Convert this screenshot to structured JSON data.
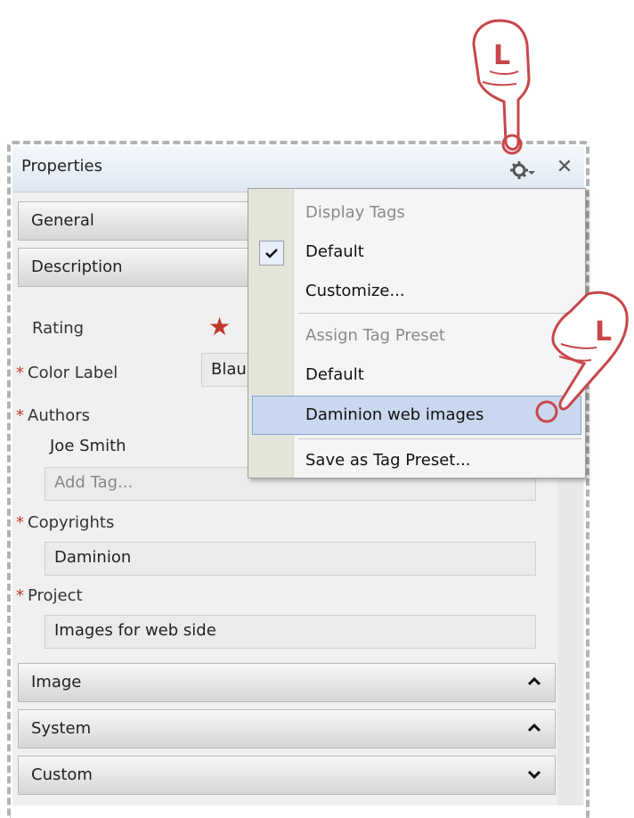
{
  "panel": {
    "title": "Properties"
  },
  "sections": {
    "general": "General",
    "description": "Description",
    "image": "Image",
    "system": "System",
    "custom": "Custom"
  },
  "fields": {
    "rating_label": "Rating",
    "color_label": "Color Label",
    "color_value": "Blau",
    "required_mark": "*",
    "authors_label": "Authors",
    "authors_value": "Joe Smith",
    "add_tag_placeholder": "Add Tag...",
    "copyrights_label": "Copyrights",
    "copyrights_value": "Daminion",
    "project_label": "Project",
    "project_value": "Images for web side"
  },
  "menu": {
    "display_tags_header": "Display Tags",
    "default_display": "Default",
    "customize": "Customize...",
    "assign_preset_header": "Assign Tag Preset",
    "default_preset": "Default",
    "daminion_web": "Daminion web images",
    "save_preset": "Save as Tag Preset..."
  },
  "hand_letter": "L",
  "colors": {
    "accent_star": "#c0392b",
    "menu_highlight": "#c9d8ee",
    "hand_red": "#d0484c"
  },
  "icons": [
    "gear-icon",
    "close-icon",
    "chevron-up-icon",
    "chevron-down-icon",
    "star-icon",
    "checkmark-icon",
    "pointing-hand-icon"
  ]
}
